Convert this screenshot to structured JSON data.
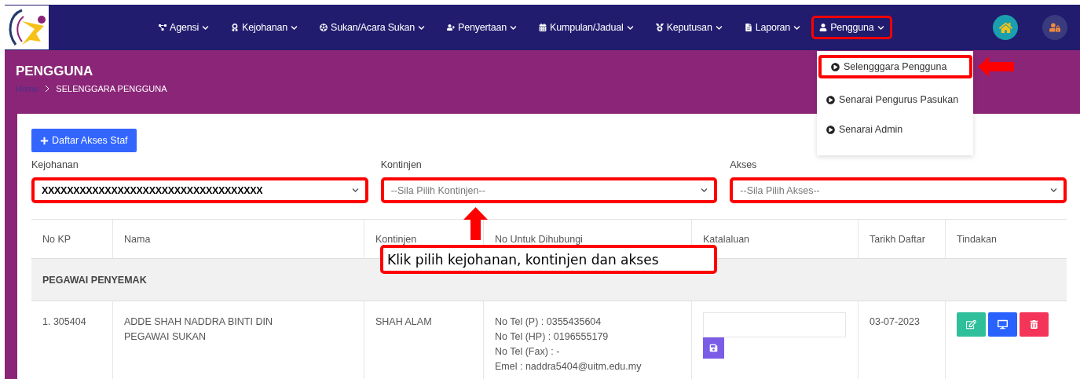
{
  "nav": {
    "items": [
      {
        "label": "Agensi",
        "kind": "agency",
        "highlighted": false
      },
      {
        "label": "Kejohanan",
        "kind": "championship",
        "highlighted": false
      },
      {
        "label": "Sukan/Acara Sukan",
        "kind": "sport",
        "highlighted": false
      },
      {
        "label": "Penyertaan",
        "kind": "entry",
        "highlighted": false
      },
      {
        "label": "Kumpulan/Jadual",
        "kind": "schedule",
        "highlighted": false
      },
      {
        "label": "Keputusan",
        "kind": "result",
        "highlighted": false
      },
      {
        "label": "Laporan",
        "kind": "report",
        "highlighted": false
      },
      {
        "label": "Pengguna",
        "kind": "user",
        "highlighted": true
      }
    ],
    "dropdown": [
      {
        "label": "Selengggara Pengguna",
        "highlighted": true
      },
      {
        "label": "Senarai Pengurus Pasukan",
        "highlighted": false
      },
      {
        "label": "Senarai Admin",
        "highlighted": false
      }
    ]
  },
  "header": {
    "title": "PENGGUNA",
    "breadcrumb": [
      "Home",
      "SELENGGARA PENGGUNA"
    ]
  },
  "add_button": "Daftar Akses Staf",
  "filters": [
    {
      "label": "Kejohanan",
      "value": "XXXXXXXXXXXXXXXXXXXXXXXXXXXXXXXXXXX",
      "highlighted": true
    },
    {
      "label": "Kontinjen",
      "placeholder": "--Sila Pilih Kontinjen--",
      "highlighted": true
    },
    {
      "label": "Akses",
      "placeholder": "--Sila Pilih Akses--",
      "highlighted": true
    }
  ],
  "callout": "Klik pilih kejohanan, kontinjen dan akses",
  "table": {
    "columns": [
      "No KP",
      "Nama",
      "Kontinjen",
      "No Untuk Dihubungi",
      "Katalaluan",
      "Tarikh Daftar",
      "Tindakan"
    ],
    "group": "PEGAWAI PENYEMAK",
    "rows": [
      {
        "no_kp": "1. 305404",
        "nama": [
          "ADDE SHAH NADDRA BINTI DIN",
          "PEGAWAI SUKAN"
        ],
        "kontinjen": "SHAH ALAM",
        "contact": [
          "No Tel (P) : 0355435604",
          "No Tel (HP) : 0196555179",
          "No Tel (Fax) : -",
          "Emel : naddra5404@uitm.edu.my"
        ],
        "tarikh": "03-07-2023"
      }
    ]
  }
}
